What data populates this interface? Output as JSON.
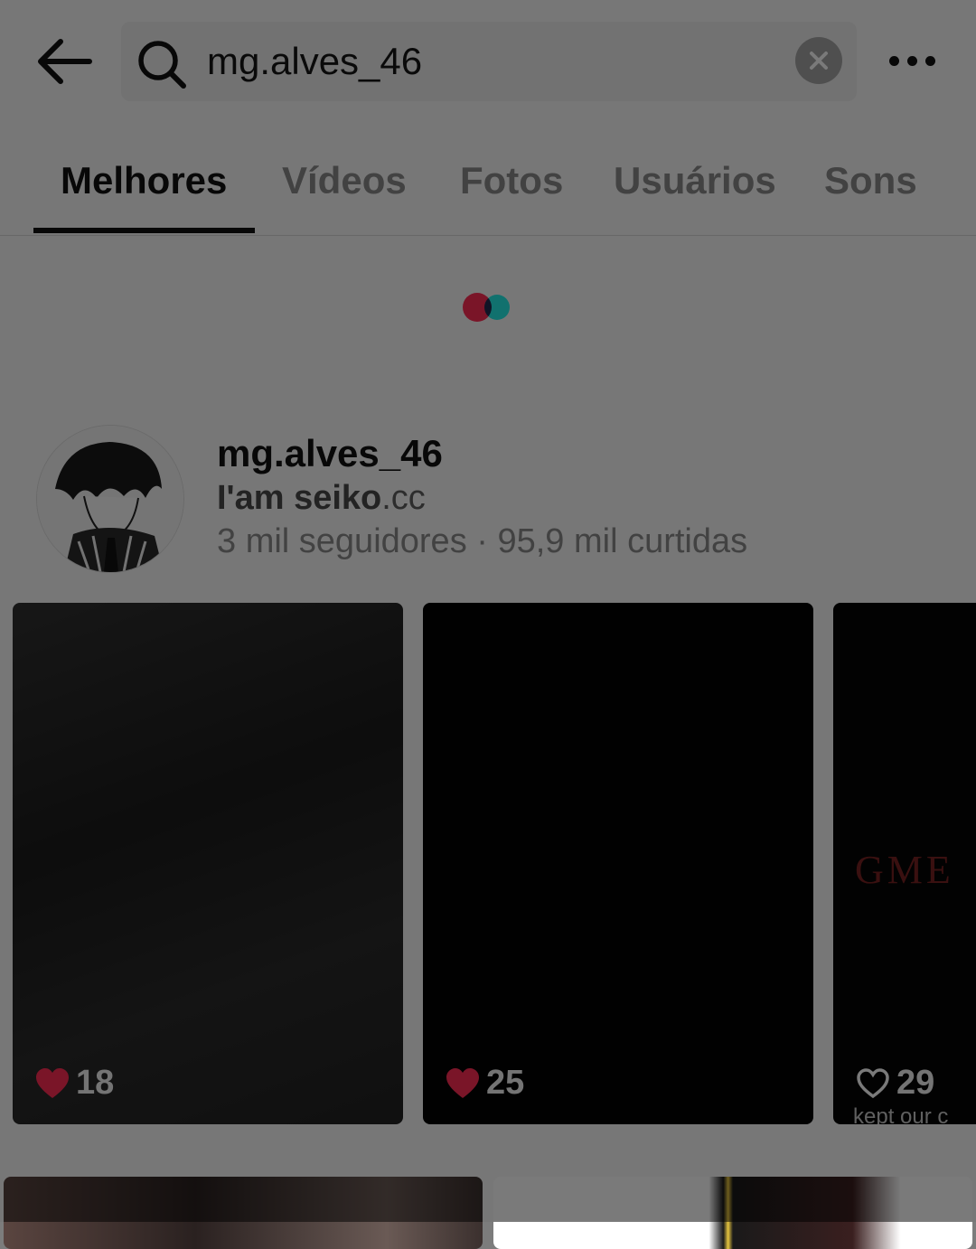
{
  "header": {
    "search_value": "mg.alves_46",
    "icons": {
      "back": "arrow-left-icon",
      "search": "search-icon",
      "clear": "close-icon",
      "more": "more-horizontal-icon"
    }
  },
  "tabs": [
    "Melhores",
    "Vídeos",
    "Fotos",
    "Usuários",
    "Sons"
  ],
  "active_tab": "Melhores",
  "user": {
    "username": "mg.alves_46",
    "bio_bold": "I'am seiko",
    "bio_rest": ".cc",
    "stats": "3 mil seguidores · 95,9 mil curtidas"
  },
  "videos": [
    {
      "likes": "18",
      "liked": true
    },
    {
      "likes": "25",
      "liked": true
    },
    {
      "likes": "29",
      "liked": false,
      "overlay_text": "GME",
      "caption": "kept our c"
    }
  ],
  "colors": {
    "accent_red": "#fe2c55",
    "accent_cyan": "#25f4ee",
    "text": "#121212",
    "muted": "#8a8a8a"
  }
}
